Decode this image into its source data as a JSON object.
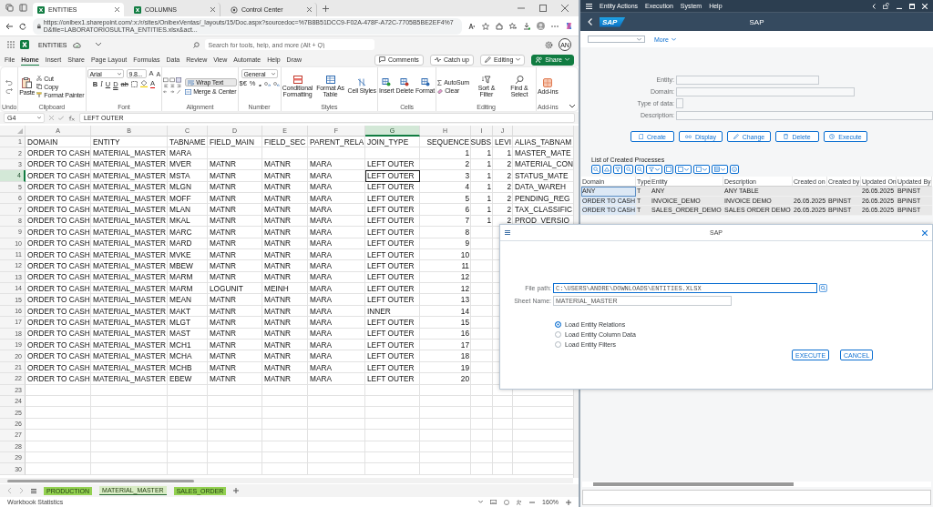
{
  "browser": {
    "tabs": [
      {
        "label": "ENTITIES",
        "kind": "excel",
        "selected": true
      },
      {
        "label": "COLUMNS",
        "kind": "excel",
        "selected": false
      },
      {
        "label": "Control Center",
        "kind": "web",
        "selected": false
      }
    ],
    "url": "https://onibex1.sharepoint.com/:x:/r/sites/OnibexVentas/_layouts/15/Doc.aspx?sourcedoc=%7B8B51DCC9-F02A-478F-A72C-7705B5BE2EF4%7D&file=LABORATORIOSULTRA_ENTITIES.xlsx&act..."
  },
  "excel": {
    "file_name": "ENTITIES",
    "search": {
      "placeholder": "Search for tools, help, and more (Alt + Q)"
    },
    "avatar": "AN",
    "ribbon_tabs": [
      {
        "label": "File",
        "selected": false
      },
      {
        "label": "Home",
        "selected": true
      },
      {
        "label": "Insert",
        "selected": false
      },
      {
        "label": "Share",
        "selected": false
      },
      {
        "label": "Page Layout",
        "selected": false
      },
      {
        "label": "Formulas",
        "selected": false
      },
      {
        "label": "Data",
        "selected": false
      },
      {
        "label": "Review",
        "selected": false
      },
      {
        "label": "View",
        "selected": false
      },
      {
        "label": "Automate",
        "selected": false
      },
      {
        "label": "Help",
        "selected": false
      },
      {
        "label": "Draw",
        "selected": false
      }
    ],
    "ribbon_actions": [
      "Comments",
      "Catch up",
      "Editing",
      "Share"
    ],
    "groups": {
      "undo": {
        "label": "Undo"
      },
      "clipboard": {
        "label": "Clipboard",
        "paste": "Paste",
        "items": [
          "Cut",
          "Copy",
          "Format Painter"
        ]
      },
      "font": {
        "label": "Font",
        "font_name": "Arial",
        "font_size": "9.8...",
        "size_letters": [
          "A",
          "A"
        ],
        "format_buttons": [
          "B",
          "I",
          "U",
          "D",
          "ab"
        ],
        "color_letter": "A"
      },
      "alignment": {
        "label": "Alignment",
        "wrap_text": "Wrap Text",
        "merge": "Merge & Center"
      },
      "number": {
        "label": "Number",
        "format": "General",
        "symbols": [
          "$€",
          "%",
          "❟"
        ]
      },
      "styles": {
        "label": "Styles",
        "items": [
          "Conditional Formatting",
          "Format As Table",
          "Cell Styles"
        ]
      },
      "cells": {
        "label": "Cells",
        "items": [
          "Insert",
          "Delete",
          "Format"
        ]
      },
      "editing": {
        "label": "Editing",
        "items": [
          "AutoSum",
          "Clear",
          "Sort & Filter",
          "Find & Select"
        ]
      },
      "addins": {
        "label": "Add-ins",
        "items": [
          "Add-ins"
        ]
      }
    },
    "formula_bar": {
      "cell": "G4",
      "value": "LEFT OUTER"
    },
    "grid": {
      "columns": [
        {
          "letter": "A",
          "kind": "text",
          "selected": false
        },
        {
          "letter": "B",
          "kind": "text",
          "selected": false
        },
        {
          "letter": "C",
          "kind": "text",
          "selected": false
        },
        {
          "letter": "D",
          "kind": "text",
          "selected": false
        },
        {
          "letter": "E",
          "kind": "text",
          "selected": false
        },
        {
          "letter": "F",
          "kind": "text",
          "selected": false
        },
        {
          "letter": "G",
          "kind": "text",
          "selected": true
        },
        {
          "letter": "H",
          "kind": "number",
          "selected": false
        },
        {
          "letter": "I",
          "kind": "number",
          "selected": false
        },
        {
          "letter": "J",
          "kind": "number",
          "selected": false
        },
        {
          "kind": "text",
          "selected": false
        }
      ],
      "rows": [
        {
          "number": "1",
          "selected": false,
          "cells": [
            "DOMAIN",
            "ENTITY",
            "TABNAME",
            "FIELD_MAIN",
            "FIELD_SEC",
            "PARENT_RELA",
            "JOIN_TYPE",
            "SEQUENCE",
            "SUBS",
            "LEVI",
            "ALIAS_TABNAM"
          ]
        },
        {
          "number": "2",
          "selected": false,
          "cells": [
            "ORDER TO CASH",
            "MATERIAL_MASTER",
            "MARA",
            null,
            null,
            null,
            null,
            "1",
            "1",
            "1",
            "MASTER_MATE"
          ]
        },
        {
          "number": "3",
          "selected": false,
          "cells": [
            "ORDER TO CASH",
            "MATERIAL_MASTER",
            "MVER",
            "MATNR",
            "MATNR",
            "MARA",
            "LEFT OUTER",
            "2",
            "1",
            "2",
            "MATERIAL_CON"
          ]
        },
        {
          "number": "4",
          "selected": true,
          "cells": [
            "ORDER TO CASH",
            "MATERIAL_MASTER",
            "MSTA",
            "MATNR",
            "MATNR",
            "MARA",
            "LEFT OUTER",
            "3",
            "1",
            "2",
            "STATUS_MATE"
          ]
        },
        {
          "number": "5",
          "selected": false,
          "cells": [
            "ORDER TO CASH",
            "MATERIAL_MASTER",
            "MLGN",
            "MATNR",
            "MATNR",
            "MARA",
            "LEFT OUTER",
            "4",
            "1",
            "2",
            "DATA_WAREH"
          ]
        },
        {
          "number": "6",
          "selected": false,
          "cells": [
            "ORDER TO CASH",
            "MATERIAL_MASTER",
            "MOFF",
            "MATNR",
            "MATNR",
            "MARA",
            "LEFT OUTER",
            "5",
            "1",
            "2",
            "PENDING_REG"
          ]
        },
        {
          "number": "7",
          "selected": false,
          "cells": [
            "ORDER TO CASH",
            "MATERIAL_MASTER",
            "MLAN",
            "MATNR",
            "MATNR",
            "MARA",
            "LEFT OUTER",
            "6",
            "1",
            "2",
            "TAX_CLASSIFIC"
          ]
        },
        {
          "number": "8",
          "selected": false,
          "cells": [
            "ORDER TO CASH",
            "MATERIAL_MASTER",
            "MKAL",
            "MATNR",
            "MATNR",
            "MARA",
            "LEFT OUTER",
            "7",
            "1",
            "2",
            "PROD_VERSIO"
          ]
        },
        {
          "number": "9",
          "selected": false,
          "cells": [
            "ORDER TO CASH",
            "MATERIAL_MASTER",
            "MARC",
            "MATNR",
            "MATNR",
            "MARA",
            "LEFT OUTER",
            "8"
          ]
        },
        {
          "number": "10",
          "selected": false,
          "cells": [
            "ORDER TO CASH",
            "MATERIAL_MASTER",
            "MARD",
            "MATNR",
            "MATNR",
            "MARA",
            "LEFT OUTER",
            "9"
          ]
        },
        {
          "number": "11",
          "selected": false,
          "cells": [
            "ORDER TO CASH",
            "MATERIAL_MASTER",
            "MVKE",
            "MATNR",
            "MATNR",
            "MARA",
            "LEFT OUTER",
            "10"
          ]
        },
        {
          "number": "12",
          "selected": false,
          "cells": [
            "ORDER TO CASH",
            "MATERIAL_MASTER",
            "MBEW",
            "MATNR",
            "MATNR",
            "MARA",
            "LEFT OUTER",
            "11"
          ]
        },
        {
          "number": "13",
          "selected": false,
          "cells": [
            "ORDER TO CASH",
            "MATERIAL_MASTER",
            "MARM",
            "MATNR",
            "MATNR",
            "MARA",
            "LEFT OUTER",
            "12"
          ]
        },
        {
          "number": "14",
          "selected": false,
          "cells": [
            "ORDER TO CASH",
            "MATERIAL_MASTER",
            "MARM",
            "LOGUNIT",
            "MEINH",
            "MARA",
            "LEFT OUTER",
            "12"
          ]
        },
        {
          "number": "15",
          "selected": false,
          "cells": [
            "ORDER TO CASH",
            "MATERIAL_MASTER",
            "MEAN",
            "MATNR",
            "MATNR",
            "MARA",
            "LEFT OUTER",
            "13"
          ]
        },
        {
          "number": "16",
          "selected": false,
          "cells": [
            "ORDER TO CASH",
            "MATERIAL_MASTER",
            "MAKT",
            "MATNR",
            "MATNR",
            "MARA",
            "INNER",
            "14"
          ]
        },
        {
          "number": "17",
          "selected": false,
          "cells": [
            "ORDER TO CASH",
            "MATERIAL_MASTER",
            "MLGT",
            "MATNR",
            "MATNR",
            "MARA",
            "LEFT OUTER",
            "15"
          ]
        },
        {
          "number": "18",
          "selected": false,
          "cells": [
            "ORDER TO CASH",
            "MATERIAL_MASTER",
            "MAST",
            "MATNR",
            "MATNR",
            "MARA",
            "LEFT OUTER",
            "16"
          ]
        },
        {
          "number": "19",
          "selected": false,
          "cells": [
            "ORDER TO CASH",
            "MATERIAL_MASTER",
            "MCH1",
            "MATNR",
            "MATNR",
            "MARA",
            "LEFT OUTER",
            "17"
          ]
        },
        {
          "number": "20",
          "selected": false,
          "cells": [
            "ORDER TO CASH",
            "MATERIAL_MASTER",
            "MCHA",
            "MATNR",
            "MATNR",
            "MARA",
            "LEFT OUTER",
            "18"
          ]
        },
        {
          "number": "21",
          "selected": false,
          "cells": [
            "ORDER TO CASH",
            "MATERIAL_MASTER",
            "MCHB",
            "MATNR",
            "MATNR",
            "MARA",
            "LEFT OUTER",
            "19"
          ]
        },
        {
          "number": "22",
          "selected": false,
          "cells": [
            "ORDER TO CASH",
            "MATERIAL_MASTER",
            "EBEW",
            "MATNR",
            "MATNR",
            "MARA",
            "LEFT OUTER",
            "20"
          ]
        },
        {
          "number": "23",
          "selected": false
        },
        {
          "number": "24",
          "selected": false
        },
        {
          "number": "25",
          "selected": false
        },
        {
          "number": "26",
          "selected": false
        },
        {
          "number": "27",
          "selected": false
        },
        {
          "number": "28",
          "selected": false
        },
        {
          "number": "29",
          "selected": false
        },
        {
          "number": "30",
          "selected": false
        }
      ]
    },
    "sheets": [
      {
        "label": "PRODUCTION",
        "selected": false
      },
      {
        "label": "MATERIAL_MASTER",
        "selected": true
      },
      {
        "label": "SALES_ORDER",
        "selected": false
      }
    ],
    "status": {
      "left": "Workbook Statistics",
      "zoom": "160%"
    }
  },
  "sap": {
    "menu": [
      "Entity Actions",
      "Execution",
      "System",
      "Help"
    ],
    "logo": "SAP",
    "title": "SAP",
    "more": "More",
    "form": [
      {
        "label": "Entity:",
        "kind": "medium"
      },
      {
        "label": "Domain:",
        "kind": "long"
      },
      {
        "label": "Type of data:",
        "kind": "short"
      },
      {
        "label": "Description:",
        "kind": "full"
      }
    ],
    "buttons": [
      "Create",
      "Display",
      "Change",
      "Delete",
      "Execute"
    ],
    "list_title": "List of Created Processes",
    "table": {
      "columns": [
        "Domain",
        "Type",
        "Entity",
        "Description",
        "Created on",
        "Created by",
        "Updated On",
        "Updated By"
      ],
      "rows": [
        {
          "selected": true,
          "cells": [
            "ANY",
            "T",
            "ANY",
            "ANY TABLE",
            null,
            null,
            "26.05.2025",
            "BPINST"
          ]
        },
        {
          "selected": false,
          "cells": [
            "ORDER TO CASH",
            "T",
            "INVOICE_DEMO",
            "INVOICE DEMO",
            "26.05.2025",
            "BPINST",
            "26.05.2025",
            "BPINST"
          ]
        },
        {
          "selected": false,
          "cells": [
            "ORDER TO CASH",
            "T",
            "SALES_ORDER_DEMO",
            "SALES ORDER DEMO",
            "26.05.2025",
            "BPINST",
            "26.05.2025",
            "BPINST"
          ]
        }
      ]
    }
  },
  "dialog": {
    "title": "SAP",
    "fields": [
      {
        "label": "File path:",
        "value": "C:\\USERS\\ANDRE\\DOWNLOADS\\ENTITIES.XLSX",
        "kind": "file"
      },
      {
        "label": "Sheet Name:",
        "value": "MATERIAL_MASTER",
        "kind": "text"
      }
    ],
    "options": [
      {
        "label": "Load Entity Relations",
        "selected": true
      },
      {
        "label": "Load Entity Column Data",
        "selected": false
      },
      {
        "label": "Load Entity Filters",
        "selected": false
      }
    ],
    "buttons": [
      "EXECUTE",
      "CANCEL"
    ]
  }
}
